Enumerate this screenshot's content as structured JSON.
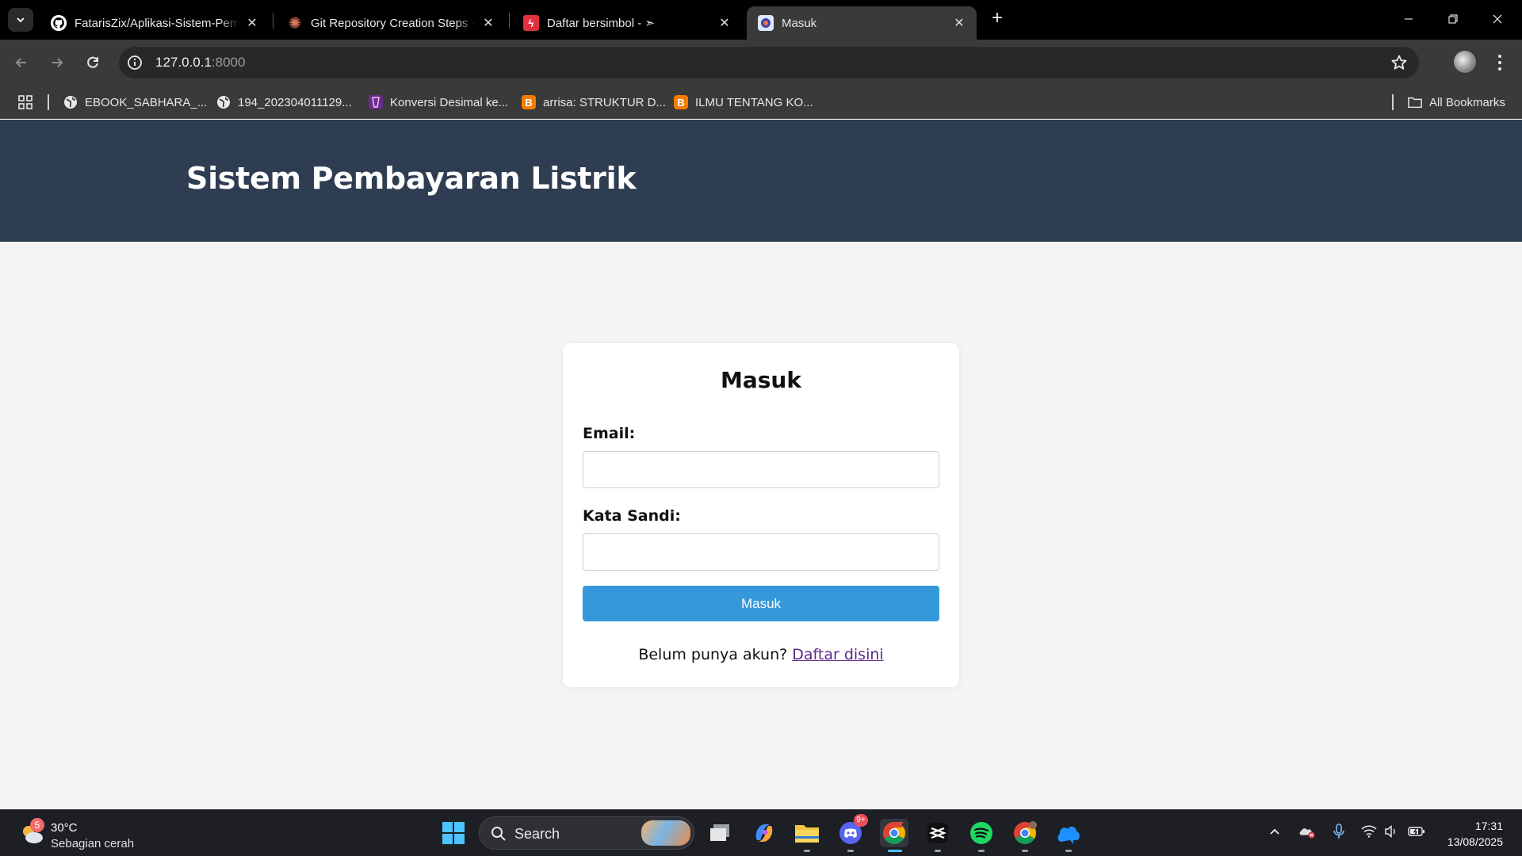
{
  "browser": {
    "tabs": [
      {
        "title": "FatarisZix/Aplikasi-Sistem-Pembayaran",
        "icon": "github-icon",
        "active": false
      },
      {
        "title": "Git Repository Creation Steps -",
        "icon": "claude-icon",
        "active": false
      },
      {
        "title": "Daftar bersimbol - ➣",
        "icon": "symbol-site-icon",
        "active": false
      },
      {
        "title": "Masuk",
        "icon": "site-icon",
        "active": true
      }
    ],
    "url_host": "127.0.0.1",
    "url_port": ":8000",
    "bookmarks": [
      {
        "label": "EBOOK_SABHARA_...",
        "icon": "globe-icon"
      },
      {
        "label": "194_202304011129...",
        "icon": "globe-icon"
      },
      {
        "label": "Konversi Desimal ke...",
        "icon": "bookmark-purple-icon"
      },
      {
        "label": "arrisa: STRUKTUR D...",
        "icon": "blogger-icon"
      },
      {
        "label": "ILMU TENTANG KO...",
        "icon": "blogger-icon"
      }
    ],
    "all_bookmarks_label": "All Bookmarks"
  },
  "page": {
    "site_title": "Sistem Pembayaran Listrik",
    "form": {
      "heading": "Masuk",
      "email_label": "Email:",
      "email_value": "",
      "password_label": "Kata Sandi:",
      "password_value": "",
      "submit_label": "Masuk",
      "register_prompt": "Belum punya akun?",
      "register_link": "Daftar disini"
    }
  },
  "taskbar": {
    "weather_temp": "30°C",
    "weather_condition": "Sebagian cerah",
    "weather_badge": "5",
    "search_label": "Search",
    "discord_badge": "9+",
    "time": "17:31",
    "date": "13/08/2025"
  },
  "colors": {
    "header_bg": "#2e3d51",
    "button_bg": "#3598db",
    "link": "#5b2a86",
    "page_bg": "#f4f4f4"
  }
}
